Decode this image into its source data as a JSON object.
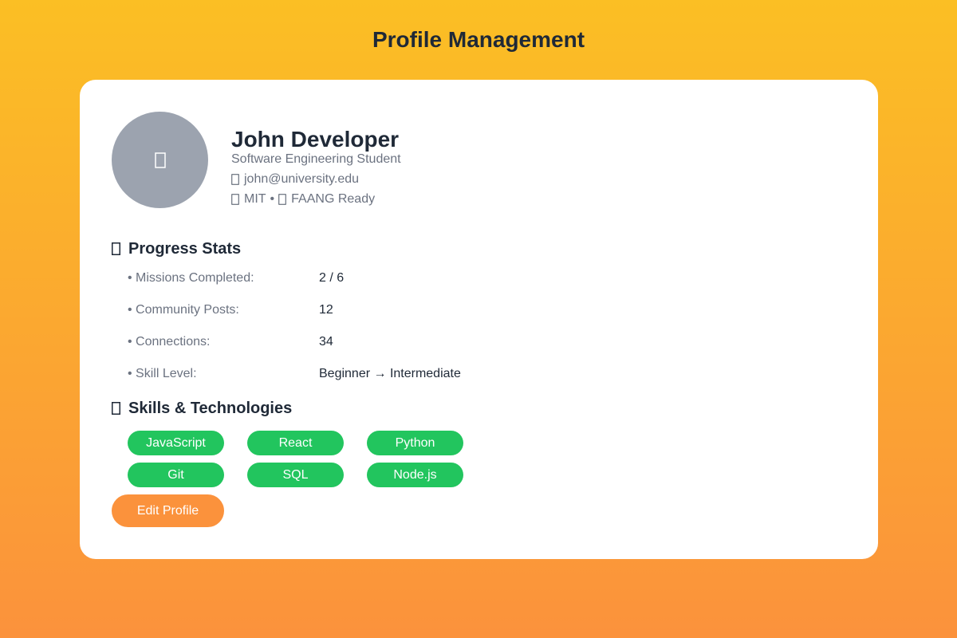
{
  "page": {
    "title": "Profile Management"
  },
  "profile": {
    "avatar_icon": "missing-glyph-icon",
    "name": "John Developer",
    "role": "Software Engineering Student",
    "email_icon": "missing-glyph-icon",
    "email": "john@university.edu",
    "school_icon": "missing-glyph-icon",
    "school": "MIT",
    "separator": "•",
    "goal_icon": "missing-glyph-icon",
    "goal": "FAANG Ready"
  },
  "progress": {
    "title_icon": "missing-glyph-icon",
    "title": "Progress Stats",
    "stats": [
      {
        "label": "• Missions Completed:",
        "value": "2 / 6"
      },
      {
        "label": "• Community Posts:",
        "value": "12"
      },
      {
        "label": "• Connections:",
        "value": "34"
      },
      {
        "label": "• Skill Level:",
        "value": "Beginner → Intermediate"
      }
    ]
  },
  "skills": {
    "title_icon": "missing-glyph-icon",
    "title": "Skills & Technologies",
    "tags": [
      "JavaScript",
      "React",
      "Python",
      "Git",
      "SQL",
      "Node.js"
    ]
  },
  "actions": {
    "edit_label": "Edit Profile"
  },
  "colors": {
    "background_top": "#fbbf24",
    "background_bottom": "#fb923c",
    "card": "#ffffff",
    "text_primary": "#1f2937",
    "text_secondary": "#6b7280",
    "avatar": "#9ca3af",
    "skill_tag": "#22c55e",
    "edit_button": "#fb923c"
  }
}
